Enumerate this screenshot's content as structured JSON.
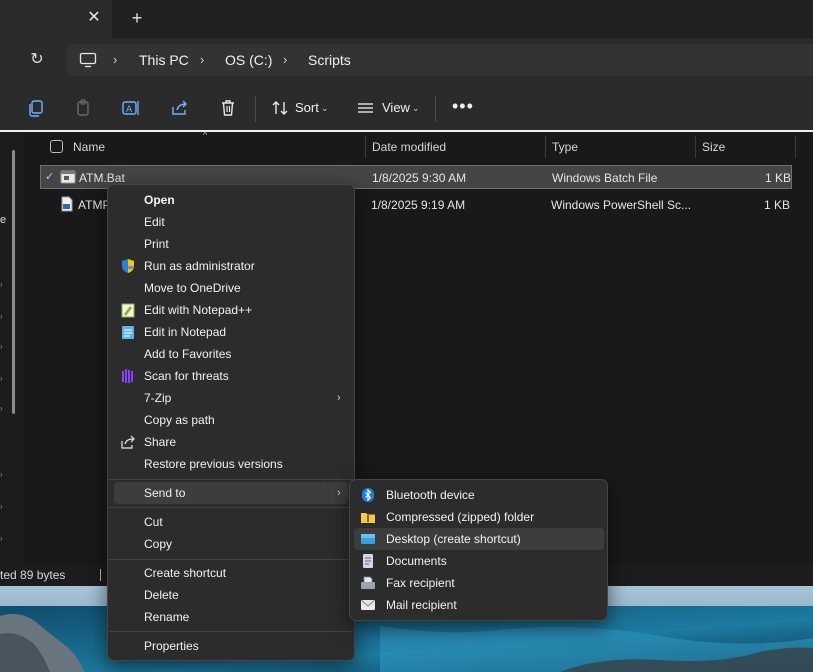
{
  "titlebar": {
    "close_glyph": "✕",
    "new_tab_glyph": "+"
  },
  "address": {
    "refresh_glyph": "↻",
    "breadcrumb": [
      "This PC",
      "OS (C:)",
      "Scripts"
    ],
    "separator": "›"
  },
  "commandbar": {
    "sort_label": "Sort",
    "view_label": "View",
    "more_glyph": "•••",
    "chevron": "⌄"
  },
  "columns": {
    "name": "Name",
    "date_modified": "Date modified",
    "type": "Type",
    "size": "Size"
  },
  "files": [
    {
      "name": "ATM.Bat",
      "date": "1/8/2025 9:30 AM",
      "type": "Windows Batch File",
      "size": "1 KB",
      "selected": true
    },
    {
      "name": "ATMP",
      "date": "1/8/2025 9:19 AM",
      "type": "Windows PowerShell Sc...",
      "size": "1 KB",
      "selected": false
    }
  ],
  "status": {
    "text": "ted  89 bytes"
  },
  "nav": {
    "cut_text": "e"
  },
  "context_menu": {
    "items": [
      {
        "label": "Open",
        "bold": true,
        "icon": ""
      },
      {
        "label": "Edit",
        "icon": ""
      },
      {
        "label": "Print",
        "icon": ""
      },
      {
        "label": "Run as administrator",
        "icon": "uac-shield-icon"
      },
      {
        "label": "Move to OneDrive",
        "icon": ""
      },
      {
        "label": "Edit with Notepad++",
        "icon": "notepad-plus-plus-icon"
      },
      {
        "label": "Edit in Notepad",
        "icon": "notepad-icon"
      },
      {
        "label": "Add to Favorites",
        "icon": ""
      },
      {
        "label": "Scan for threats",
        "icon": "defender-scan-icon"
      },
      {
        "label": "7-Zip",
        "icon": "",
        "submenu": true
      },
      {
        "label": "Copy as path",
        "icon": ""
      },
      {
        "label": "Share",
        "icon": "share-icon"
      },
      {
        "label": "Restore previous versions",
        "icon": ""
      },
      {
        "label": "Send to",
        "icon": "",
        "submenu": true,
        "highlighted": true
      },
      {
        "label": "Cut",
        "icon": ""
      },
      {
        "label": "Copy",
        "icon": ""
      },
      {
        "label": "Create shortcut",
        "icon": ""
      },
      {
        "label": "Delete",
        "icon": ""
      },
      {
        "label": "Rename",
        "icon": ""
      },
      {
        "label": "Properties",
        "icon": ""
      }
    ],
    "arrow_glyph": "›"
  },
  "send_to_menu": {
    "items": [
      {
        "label": "Bluetooth device",
        "icon": "bluetooth-icon"
      },
      {
        "label": "Compressed (zipped) folder",
        "icon": "zip-folder-icon"
      },
      {
        "label": "Desktop (create shortcut)",
        "icon": "desktop-icon",
        "highlighted": true
      },
      {
        "label": "Documents",
        "icon": "documents-icon"
      },
      {
        "label": "Fax recipient",
        "icon": "fax-icon"
      },
      {
        "label": "Mail recipient",
        "icon": "mail-icon"
      }
    ]
  }
}
